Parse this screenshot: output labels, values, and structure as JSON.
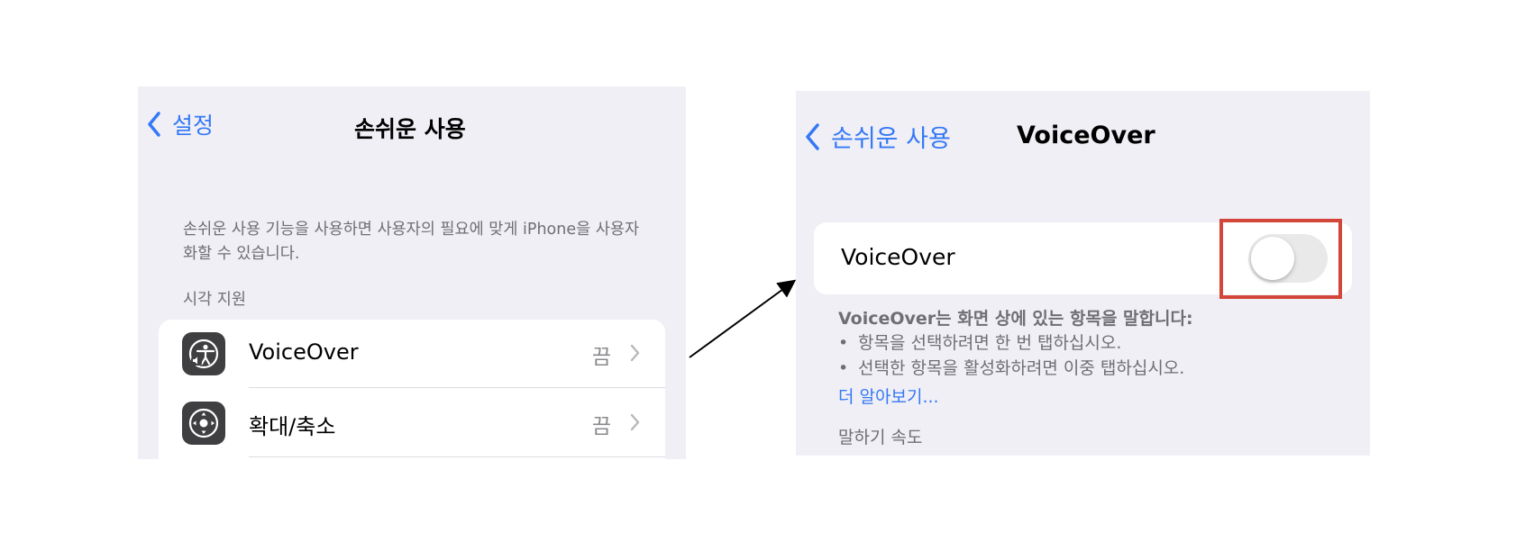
{
  "left_screen": {
    "nav": {
      "back_label": "설정",
      "title": "손쉬운 사용"
    },
    "description": "손쉬운 사용 기능을 사용하면 사용자의 필요에 맞게 iPhone을 사용자화할 수 있습니다.",
    "section_header": "시각 지원",
    "items": [
      {
        "label": "VoiceOver",
        "value": "끔",
        "icon": "voiceover-icon"
      },
      {
        "label": "확대/축소",
        "value": "끔",
        "icon": "zoom-icon"
      }
    ]
  },
  "right_screen": {
    "nav": {
      "back_label": "손쉬운 사용",
      "title": "VoiceOver"
    },
    "toggle": {
      "label": "VoiceOver",
      "state": "off"
    },
    "description_heading": "VoiceOver는 화면 상에 있는 항목을 말합니다:",
    "bullets": [
      "항목을 선택하려면 한 번 탭하십시오.",
      "선택한 항목을 활성화하려면 이중 탭하십시오."
    ],
    "learn_more": "더 알아보기...",
    "speaking_rate_label": "말하기 속도"
  },
  "colors": {
    "accent": "#3478f6",
    "background": "#f0eff5",
    "highlight": "#d2473a",
    "secondary_text": "#6e6e73"
  }
}
